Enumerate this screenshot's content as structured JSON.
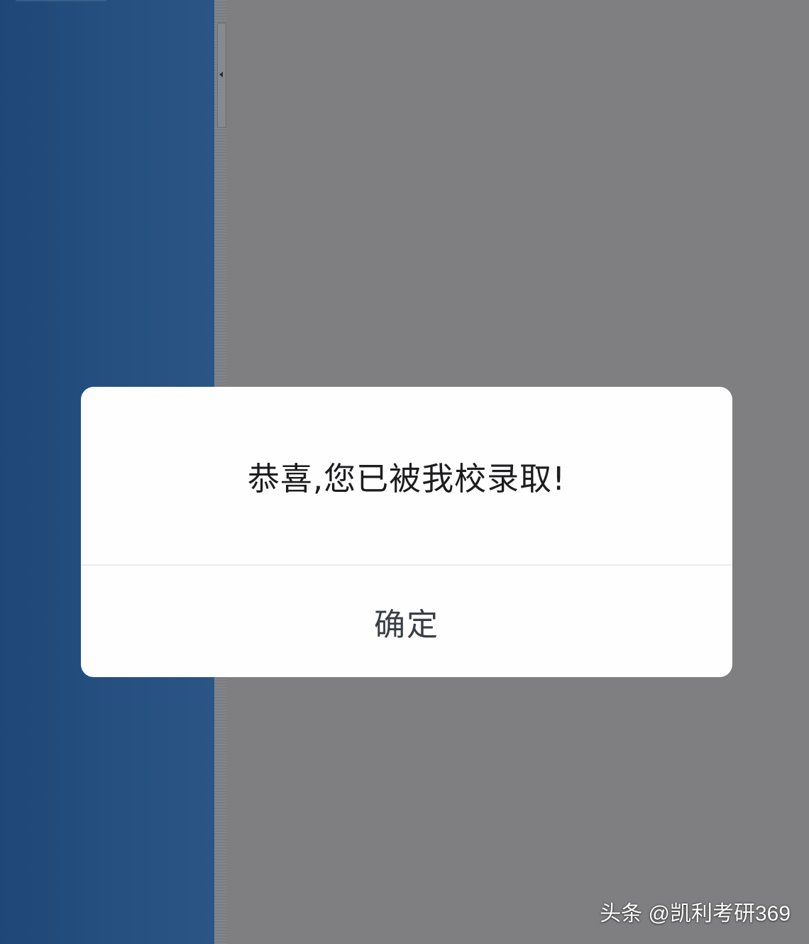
{
  "dialog": {
    "message": "恭喜,您已被我校录取!",
    "confirm_label": "确定"
  },
  "watermark": {
    "text": "头条 @凯利考研369"
  },
  "icons": {
    "collapse_handle": "chevron-left-icon"
  },
  "colors": {
    "overlay_gray": "#7f7f81",
    "left_panel_blue": "#24507f",
    "dialog_background": "#fefefe",
    "message_text": "#1d1d1f",
    "button_text": "#3a3d45"
  }
}
